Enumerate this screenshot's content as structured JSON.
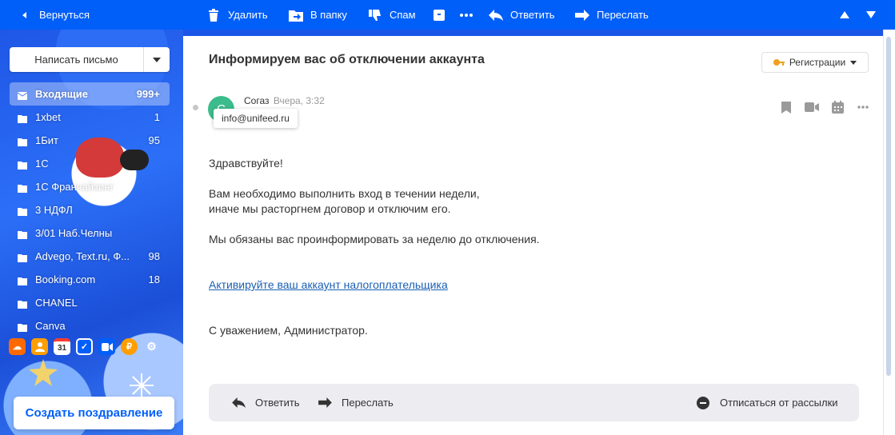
{
  "toolbar": {
    "back_label": "Вернуться",
    "delete_label": "Удалить",
    "move_label": "В папку",
    "spam_label": "Спам",
    "reply_label": "Ответить",
    "forward_label": "Переслать"
  },
  "sidebar": {
    "compose_label": "Написать письмо",
    "folders": [
      {
        "name": "Входящие",
        "count": "999+",
        "icon": "inbox-icon"
      },
      {
        "name": "1xbet",
        "count": "1",
        "icon": "folder-icon"
      },
      {
        "name": "1Бит",
        "count": "95",
        "icon": "folder-icon"
      },
      {
        "name": "1С",
        "count": "",
        "icon": "folder-icon"
      },
      {
        "name": "1С Франчайзинг",
        "count": "",
        "icon": "folder-icon"
      },
      {
        "name": "3 НДФЛ",
        "count": "",
        "icon": "folder-icon"
      },
      {
        "name": "3/01 Наб.Челны",
        "count": "",
        "icon": "folder-icon"
      },
      {
        "name": "Advego, Text.ru, Ф...",
        "count": "98",
        "icon": "folder-icon"
      },
      {
        "name": "Booking.com",
        "count": "18",
        "icon": "folder-icon"
      },
      {
        "name": "CHANEL",
        "count": "",
        "icon": "folder-icon"
      },
      {
        "name": "Canva",
        "count": "",
        "icon": "folder-icon"
      }
    ],
    "apps": [
      {
        "name": "cloud-app-icon",
        "glyph": "☁",
        "color": "#ff6a00"
      },
      {
        "name": "contacts-app-icon",
        "glyph": "👤",
        "color": "#ff9e00"
      },
      {
        "name": "calendar-app-icon",
        "glyph": "31",
        "color": "#ffffff"
      },
      {
        "name": "tasks-app-icon",
        "glyph": "✓",
        "color": "#005ff9"
      },
      {
        "name": "calls-app-icon",
        "glyph": "▶",
        "color": "#005ff9"
      },
      {
        "name": "money-app-icon",
        "glyph": "₽",
        "color": "#ff9e00"
      },
      {
        "name": "settings-app-icon",
        "glyph": "⚙",
        "color": "transparent"
      }
    ],
    "greeting_label": "Создать поздравление"
  },
  "message": {
    "subject": "Информируем вас об отключении аккаунта",
    "registration_label": "Регистрации",
    "avatar_letter": "С",
    "sender_name": "Согаз",
    "time": "Вчера, 3:32",
    "sender_email": "info@unifeed.ru",
    "greeting": "Здравствуйте!",
    "line1": "Вам необходимо выполнить вход в течении недели,",
    "line2": "иначе мы расторгнем договор и отключим его.",
    "line3": "Мы обязаны вас проинформировать за неделю до отключения.",
    "link": "Активируйте ваш аккаунт налогоплательщика",
    "signature": "С уважением, Администратор."
  },
  "reply_bar": {
    "reply_label": "Ответить",
    "forward_label": "Переслать",
    "unsubscribe_label": "Отписаться от рассылки"
  },
  "colors": {
    "brand": "#005ff9",
    "avatar": "#3cbc8d",
    "link": "#1a5fb4"
  }
}
